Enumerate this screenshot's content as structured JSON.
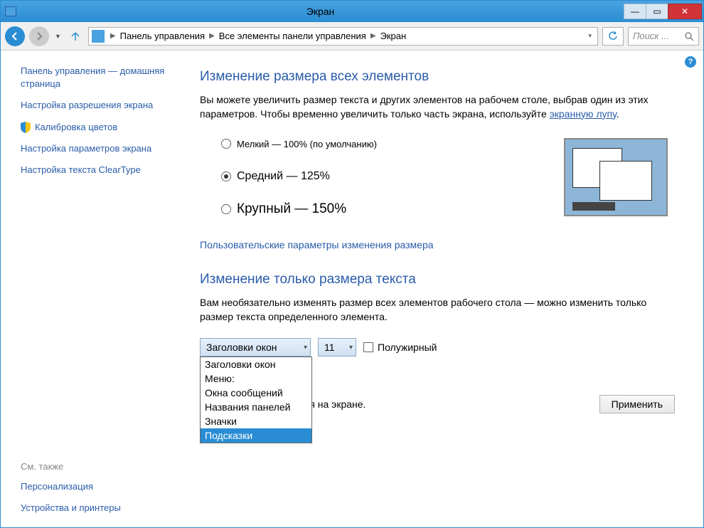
{
  "window": {
    "title": "Экран"
  },
  "breadcrumb": {
    "items": [
      "Панель управления",
      "Все элементы панели управления",
      "Экран"
    ]
  },
  "search": {
    "placeholder": "Поиск ..."
  },
  "sidebar": {
    "home": "Панель управления — домашняя страница",
    "links": [
      "Настройка разрешения экрана",
      "Калибровка цветов",
      "Настройка параметров экрана",
      "Настройка текста ClearType"
    ],
    "see_also": "См. также",
    "bottom_links": [
      "Персонализация",
      "Устройства и принтеры"
    ]
  },
  "main": {
    "heading1": "Изменение размера всех элементов",
    "desc1_a": "Вы можете увеличить размер текста и других элементов на рабочем столе, выбрав один из этих параметров. Чтобы временно увеличить только часть экрана, используйте ",
    "desc1_link": "экранную лупу",
    "desc1_b": ".",
    "radios": {
      "small": "Мелкий — 100% (по умолчанию)",
      "medium": "Средний — 125%",
      "large": "Крупный — 150%"
    },
    "custom_link": "Пользовательские параметры изменения размера",
    "heading2": "Изменение только размера текста",
    "desc2": "Вам необязательно изменять размер всех элементов рабочего стола — можно изменить только размер текста определенного элемента.",
    "combo_value": "Заголовки окон",
    "combo_options": [
      "Заголовки окон",
      "Меню:",
      "Окна сообщений",
      "Названия панелей",
      "Значки",
      "Подсказки"
    ],
    "size_value": "11",
    "bold_label": "Полужирный",
    "note": "ты могут не поместиться на экране.",
    "apply": "Применить"
  }
}
